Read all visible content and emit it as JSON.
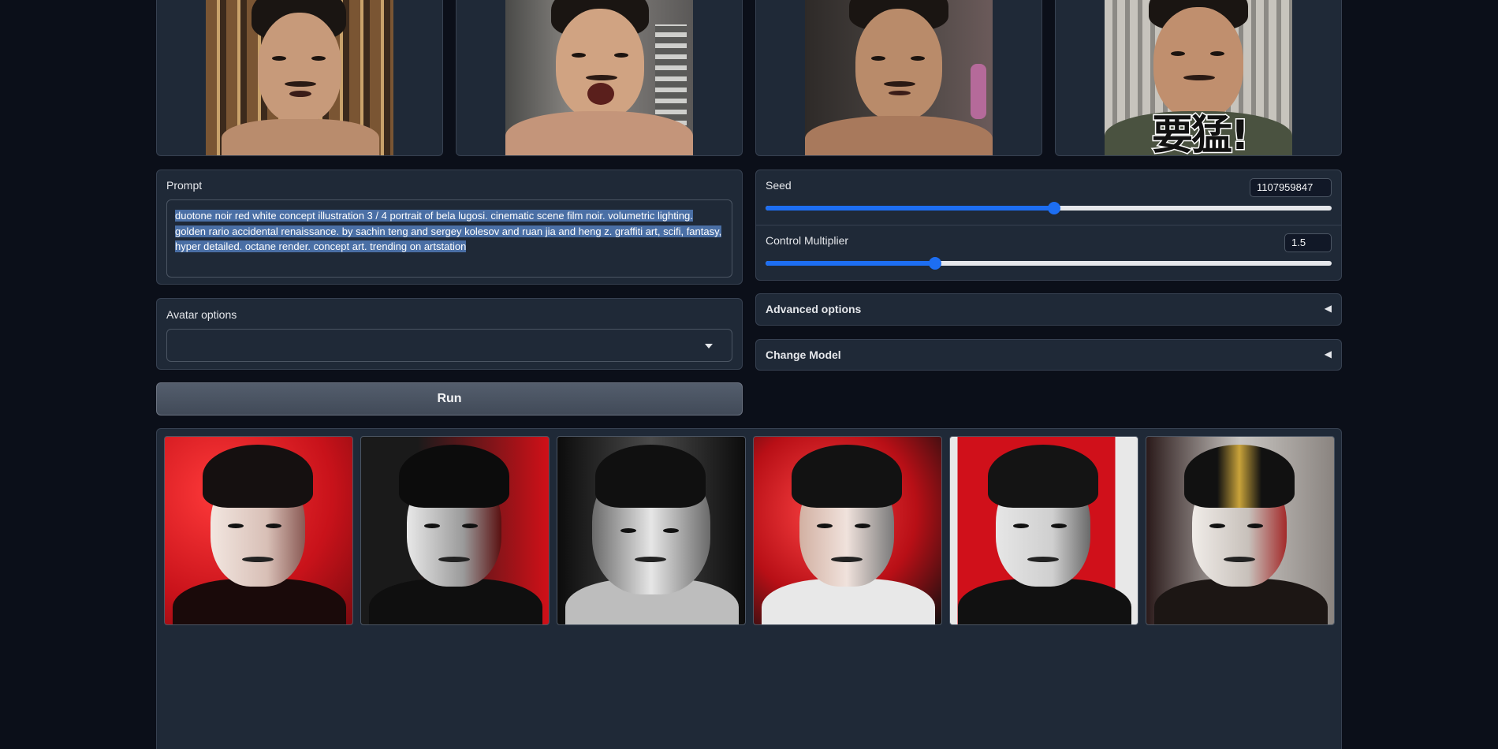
{
  "input_images": [
    {
      "alt": "reference photo 1",
      "bg": "#5a4030"
    },
    {
      "alt": "reference photo 2",
      "bg": "#6b6a68"
    },
    {
      "alt": "reference photo 3",
      "bg": "#3e3a38"
    },
    {
      "alt": "reference photo 4",
      "bg": "#8a8780",
      "overlay_text": "要猛!"
    }
  ],
  "prompt": {
    "label": "Prompt",
    "line1": "duotone noir red white concept illustration 3 / 4 portrait of bela lugosi. cinematic scene film noir. volumetric lighting.",
    "line2": "golden rario accidental renaissance. by sachin teng and sergey kolesov and ruan jia and heng z. graffiti art, scifi, fantasy,",
    "line3": "hyper detailed. octane render. concept art. trending on artstation"
  },
  "seed": {
    "label": "Seed",
    "value": "1107959847",
    "fraction": 0.51
  },
  "control_multiplier": {
    "label": "Control Multiplier",
    "value": "1.5",
    "fraction": 0.3
  },
  "avatar_options": {
    "label": "Avatar options",
    "selected": ""
  },
  "advanced_options": {
    "label": "Advanced options",
    "arrow": "◀"
  },
  "change_model": {
    "label": "Change Model",
    "arrow": "◀"
  },
  "run_button": {
    "label": "Run"
  },
  "gallery": [
    {
      "alt": "generated portrait 1",
      "style": "red"
    },
    {
      "alt": "generated portrait 2",
      "style": "dark-red"
    },
    {
      "alt": "generated portrait 3",
      "style": "mono"
    },
    {
      "alt": "generated portrait 4",
      "style": "red-glow"
    },
    {
      "alt": "generated portrait 5",
      "style": "red-white"
    },
    {
      "alt": "generated portrait 6",
      "style": "gold-mono"
    }
  ],
  "colors": {
    "background": "#0b0f19",
    "panel": "#1f2937",
    "accent": "#1d6ef2",
    "selection": "#4a6fa5"
  }
}
